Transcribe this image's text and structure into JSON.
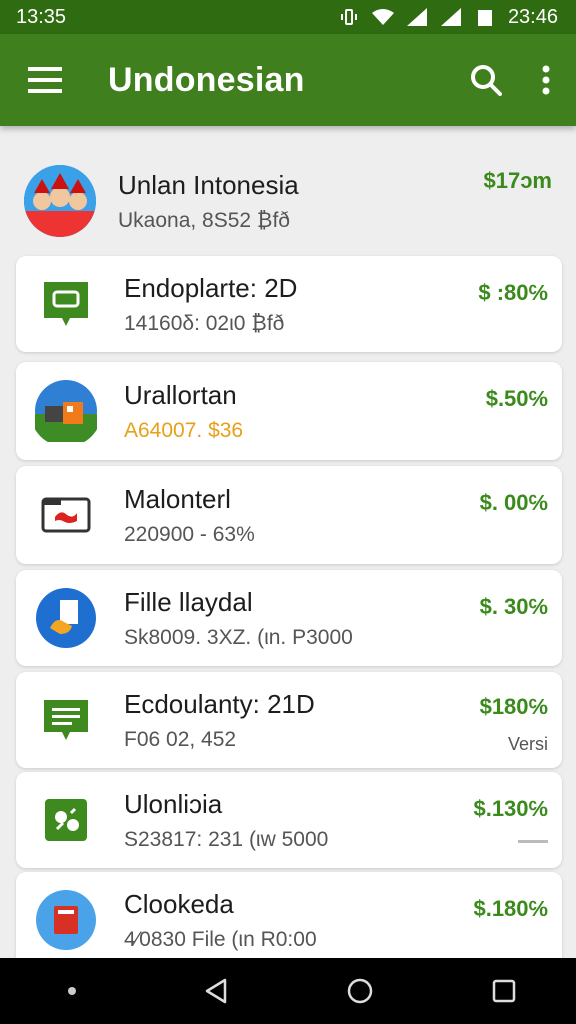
{
  "status_bar": {
    "left_time": "13:35",
    "right_time": "23:46",
    "icons": [
      "vibrate-icon",
      "wifi-icon",
      "signal-icon",
      "signal-icon",
      "battery-icon"
    ]
  },
  "app_bar": {
    "title": "Undonesian",
    "icons": [
      "menu-icon",
      "search-icon",
      "more-vert-icon"
    ]
  },
  "colors": {
    "app_bar": "#3f7f1d",
    "status_bar": "#2f6b10",
    "price_green": "#3a8a1c",
    "orange_text": "#e7a019"
  },
  "items": [
    {
      "title": "Unlan Intonesia",
      "subtitle": "Ukaona, 8S52 ₿fð",
      "price": "$17ɔm",
      "icon": "people-photo-avatar"
    },
    {
      "title": "Endoplarte: 2D",
      "subtitle": "14160δ: 02ι0 ₿fð",
      "price": "$ :80℅",
      "icon": "card-icon"
    },
    {
      "title": "Urallortan",
      "subtitle": "A64007. $36",
      "price": "$.50℅",
      "icon": "landscape-icon"
    },
    {
      "title": "Malonterl",
      "subtitle": "220900 - 63%",
      "price": "$. 00℅",
      "icon": "browser-window-icon"
    },
    {
      "title": "Fille llaydal",
      "subtitle": "Sk8009. 3XZ. (ιn. P3000",
      "price": "$. 30℅",
      "icon": "file-hand-icon"
    },
    {
      "title": "Ecdoulanty: 21D",
      "subtitle": "F06 02, 452",
      "price": "$180℅",
      "extra": "Versi",
      "icon": "message-icon"
    },
    {
      "title": "Ulonliɔia",
      "subtitle": "S23817: 231 (ιw 5000",
      "price": "$.130℅",
      "icon": "puzzle-icon"
    },
    {
      "title": "Clookeda",
      "subtitle": "4∕0830 File (ιn R0:00",
      "price": "$.180℅",
      "icon": "calendar-icon"
    }
  ]
}
